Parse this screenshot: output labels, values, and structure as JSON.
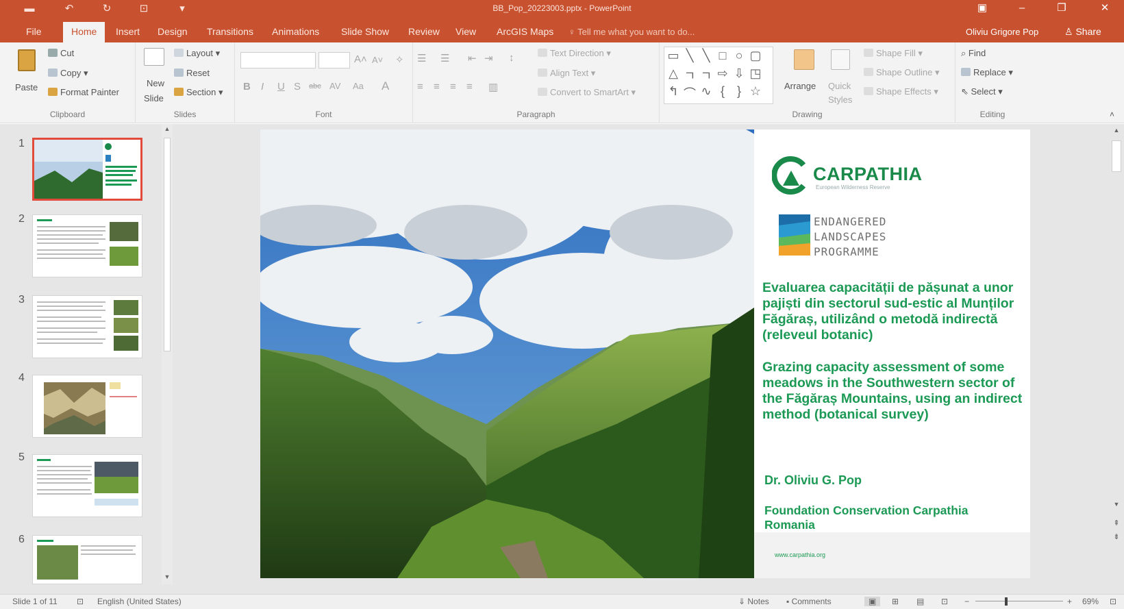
{
  "window": {
    "title": "BB_Pop_20223003.pptx - PowerPoint",
    "quick_access": [
      "save-icon",
      "undo-icon",
      "redo-icon",
      "present-icon"
    ],
    "controls": [
      "ribbon-display-icon",
      "minimize-icon",
      "restore-icon",
      "close-icon"
    ]
  },
  "menu": {
    "tabs": [
      "File",
      "Home",
      "Insert",
      "Design",
      "Transitions",
      "Animations",
      "Slide Show",
      "Review",
      "View",
      "ArcGIS Maps"
    ],
    "active_tab": "Home",
    "tell_me": "Tell me what you want to do...",
    "user": "Oliviu Grigore Pop",
    "share": "Share"
  },
  "ribbon": {
    "clipboard": {
      "paste": "Paste",
      "cut": "Cut",
      "copy": "Copy",
      "format_painter": "Format Painter",
      "label": "Clipboard"
    },
    "slides": {
      "new_slide_1": "New",
      "new_slide_2": "Slide",
      "layout": "Layout",
      "reset": "Reset",
      "section": "Section",
      "label": "Slides"
    },
    "font": {
      "label": "Font"
    },
    "paragraph": {
      "text_direction": "Text Direction",
      "align_text": "Align Text",
      "convert_smartart": "Convert to SmartArt",
      "label": "Paragraph"
    },
    "drawing": {
      "arrange": "Arrange",
      "quick_styles_1": "Quick",
      "quick_styles_2": "Styles",
      "shape_fill": "Shape Fill",
      "shape_outline": "Shape Outline",
      "shape_effects": "Shape Effects",
      "label": "Drawing"
    },
    "editing": {
      "find": "Find",
      "replace": "Replace",
      "select": "Select",
      "label": "Editing"
    }
  },
  "thumbnails": [
    "1",
    "2",
    "3",
    "4",
    "5",
    "6"
  ],
  "selected_slide": 1,
  "slide": {
    "logo_name": "CARPATHIA",
    "logo_tagline": "European Wilderness Reserve",
    "elp": [
      "ENDANGERED",
      "LANDSCAPES",
      "PROGRAMME"
    ],
    "title_ro": "Evaluarea capacității de pășunat a unor pajiști din sectorul sud-estic al Munților Făgăraș, utilizând o metodă indirectă (releveul botanic)",
    "title_en": "Grazing capacity assessment of some meadows in the Southwestern sector of the Făgăraș Mountains, using an indirect method (botanical survey)",
    "author": "Dr. Oliviu G. Pop",
    "organization": "Foundation Conservation Carpathia Romania",
    "website": "www.carpathia.org"
  },
  "status": {
    "slide_count": "Slide 1 of 11",
    "language": "English (United States)",
    "notes": "Notes",
    "comments": "Comments",
    "zoom": "69%"
  },
  "colors": {
    "accent": "#c8512f",
    "slide_text": "#1c9a55",
    "selection": "#e24a3b"
  }
}
